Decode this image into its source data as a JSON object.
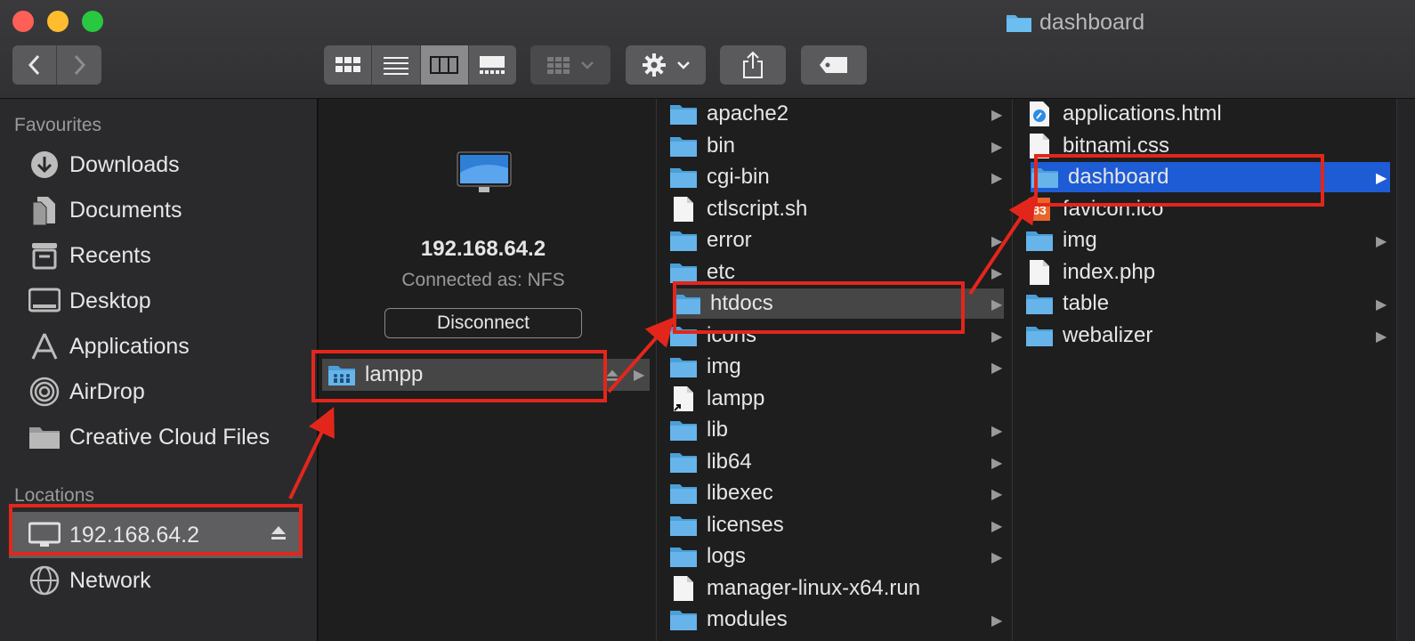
{
  "window": {
    "title": "dashboard"
  },
  "sidebar": {
    "favourites_header": "Favourites",
    "locations_header": "Locations",
    "favourites": [
      {
        "label": "Downloads",
        "icon": "downloads-icon"
      },
      {
        "label": "Documents",
        "icon": "documents-icon"
      },
      {
        "label": "Recents",
        "icon": "recents-icon"
      },
      {
        "label": "Desktop",
        "icon": "desktop-icon"
      },
      {
        "label": "Applications",
        "icon": "applications-icon"
      },
      {
        "label": "AirDrop",
        "icon": "airdrop-icon"
      },
      {
        "label": "Creative Cloud Files",
        "icon": "folder-icon"
      }
    ],
    "locations": [
      {
        "label": "192.168.64.2",
        "icon": "computer-icon"
      },
      {
        "label": "Network",
        "icon": "network-icon"
      }
    ]
  },
  "server": {
    "name": "192.168.64.2",
    "connected_as": "Connected as: NFS",
    "disconnect_label": "Disconnect",
    "volume": "lampp"
  },
  "column2": [
    {
      "name": "apache2",
      "type": "folder"
    },
    {
      "name": "bin",
      "type": "folder"
    },
    {
      "name": "cgi-bin",
      "type": "folder"
    },
    {
      "name": "ctlscript.sh",
      "type": "file"
    },
    {
      "name": "error",
      "type": "folder"
    },
    {
      "name": "etc",
      "type": "folder"
    },
    {
      "name": "htdocs",
      "type": "folder"
    },
    {
      "name": "icons",
      "type": "folder"
    },
    {
      "name": "img",
      "type": "folder"
    },
    {
      "name": "lampp",
      "type": "alias"
    },
    {
      "name": "lib",
      "type": "folder"
    },
    {
      "name": "lib64",
      "type": "folder"
    },
    {
      "name": "libexec",
      "type": "folder"
    },
    {
      "name": "licenses",
      "type": "folder"
    },
    {
      "name": "logs",
      "type": "folder"
    },
    {
      "name": "manager-linux-x64.run",
      "type": "file"
    },
    {
      "name": "modules",
      "type": "folder"
    }
  ],
  "column3": [
    {
      "name": "applications.html",
      "type": "html"
    },
    {
      "name": "bitnami.css",
      "type": "file"
    },
    {
      "name": "dashboard",
      "type": "folder"
    },
    {
      "name": "favicon.ico",
      "type": "ico"
    },
    {
      "name": "img",
      "type": "folder"
    },
    {
      "name": "index.php",
      "type": "file"
    },
    {
      "name": "table",
      "type": "folder"
    },
    {
      "name": "webalizer",
      "type": "folder"
    }
  ],
  "colors": {
    "highlight": "#e3261c",
    "selection_blue": "#1e5cd6",
    "folder": "#5fb0e6"
  }
}
